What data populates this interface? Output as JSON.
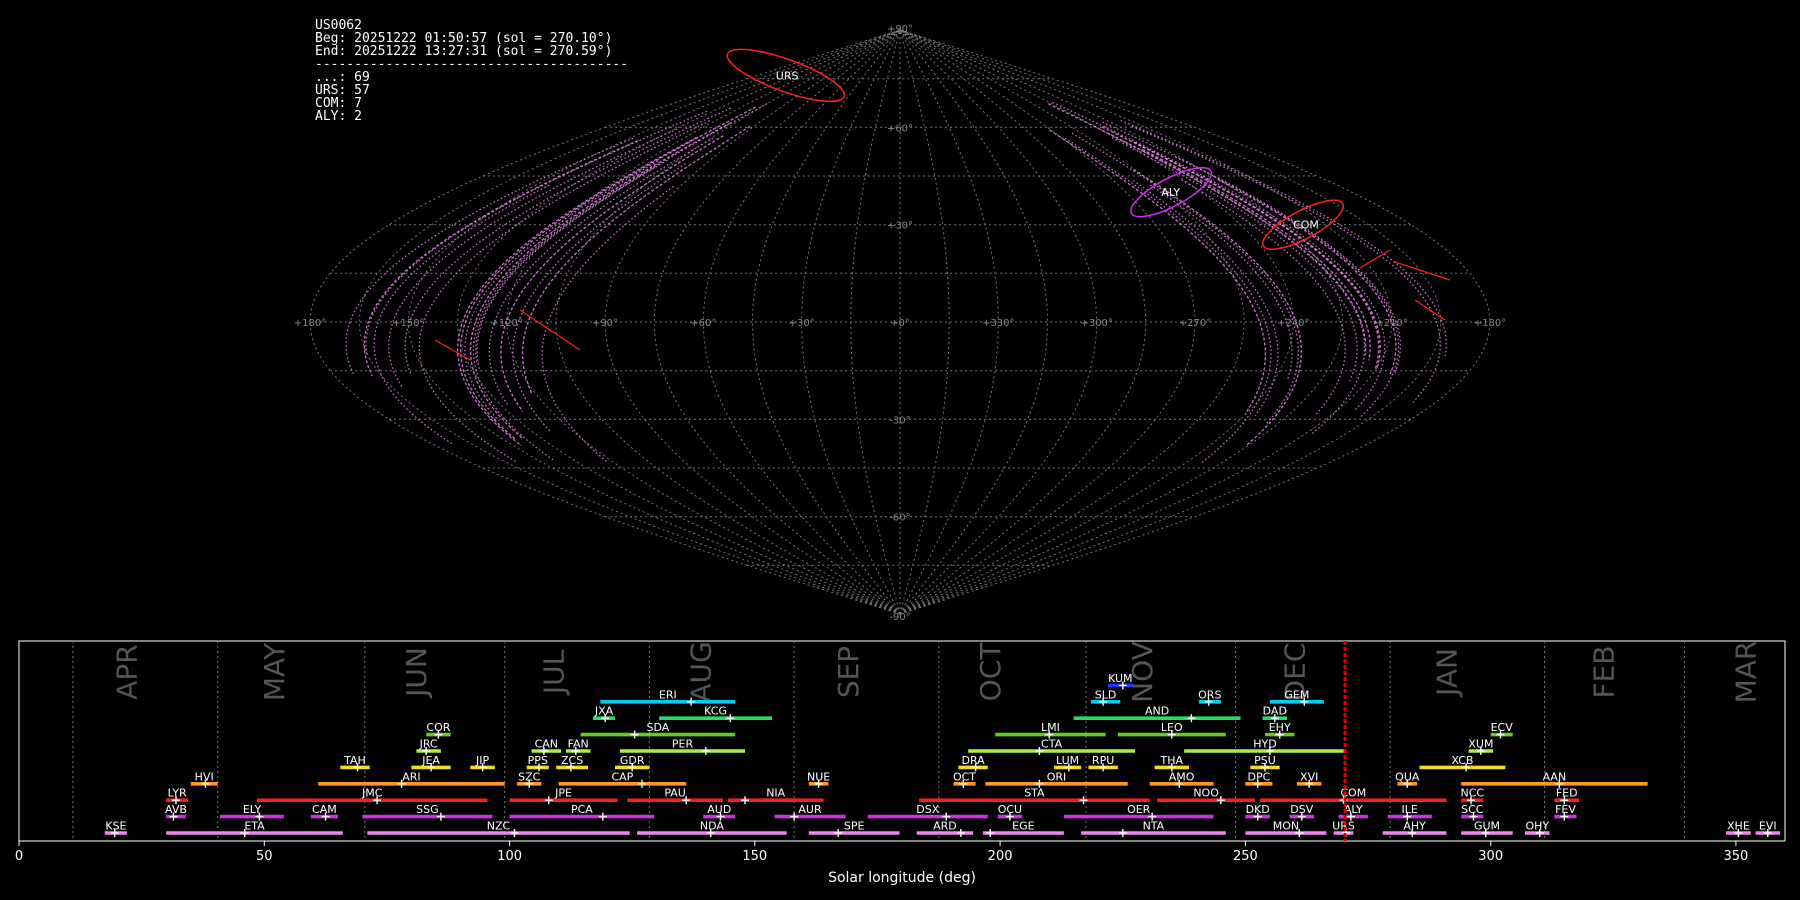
{
  "info_box": {
    "lines": [
      "US0062",
      "Beg: 20251222 01:50:57 (sol = 270.10°)",
      "End: 20251222 13:27:31 (sol = 270.59°)",
      "----------------------------------------",
      "...: 69",
      "URS: 57",
      "COM: 7",
      "ALY: 2"
    ]
  },
  "chart_data": [
    {
      "type": "scatter",
      "projection": "sinusoidal",
      "grid": true,
      "longitude_ticks": [
        "+180°",
        "+150°",
        "+120°",
        "+90°",
        "+60°",
        "+30°",
        "+0°",
        "+330°",
        "+300°",
        "+270°",
        "+240°",
        "+210°",
        "+180°"
      ],
      "latitude_ticks": [
        "+90°",
        "+60°",
        "+30°",
        "-30°",
        "-60°",
        "-90°"
      ],
      "radiants": [
        {
          "name": "URS",
          "color": "#ff2020",
          "lon": 216,
          "lat": 76
        },
        {
          "name": "ALY",
          "color": "#d030f0",
          "lon": 108,
          "lat": 40
        },
        {
          "name": "COM",
          "color": "#ff2020",
          "lon": 142,
          "lat": 30
        }
      ],
      "colors": {
        "grid": "#777777",
        "trails": "#ee88ee",
        "sporadic": "#ff2020"
      }
    },
    {
      "type": "gantt",
      "xlabel": "Solar longitude (deg)",
      "xlim": [
        0,
        360
      ],
      "xticks": [
        0,
        50,
        100,
        150,
        200,
        250,
        300,
        350
      ],
      "current_sol": 270.3,
      "months": [
        {
          "label": "APR",
          "sol_start": 11,
          "center": 24
        },
        {
          "label": "MAY",
          "sol_start": 40.5,
          "center": 54
        },
        {
          "label": "JUN",
          "sol_start": 70.5,
          "center": 83
        },
        {
          "label": "JUL",
          "sol_start": 99,
          "center": 111
        },
        {
          "label": "AUG",
          "sol_start": 128.5,
          "center": 141
        },
        {
          "label": "SEP",
          "sol_start": 158,
          "center": 171
        },
        {
          "label": "OCT",
          "sol_start": 187.5,
          "center": 200
        },
        {
          "label": "NOV",
          "sol_start": 217.5,
          "center": 231
        },
        {
          "label": "DEC",
          "sol_start": 248,
          "center": 262
        },
        {
          "label": "JAN",
          "sol_start": 279.5,
          "center": 293
        },
        {
          "label": "FEB",
          "sol_start": 311,
          "center": 325
        },
        {
          "label": "MAR",
          "sol_start": 339.5,
          "center": 354
        }
      ],
      "showers": [
        {
          "code": "KUM",
          "start": 222,
          "end": 227,
          "peak": 225,
          "row": 9,
          "color": "#2233ff"
        },
        {
          "code": "ERI",
          "start": 118.5,
          "end": 146,
          "peak": 137,
          "row": 8,
          "color": "#00ccee"
        },
        {
          "code": "SLD",
          "start": 218.5,
          "end": 224.5,
          "peak": 221,
          "row": 8,
          "color": "#00ccee"
        },
        {
          "code": "ORS",
          "start": 240.5,
          "end": 245,
          "peak": 242.5,
          "row": 8,
          "color": "#00ccee"
        },
        {
          "code": "GEM",
          "start": 255,
          "end": 266,
          "peak": 262,
          "row": 8,
          "color": "#00ccee"
        },
        {
          "code": "JXA",
          "start": 117,
          "end": 121.5,
          "peak": 119.5,
          "row": 7,
          "color": "#22dd66"
        },
        {
          "code": "KCG",
          "start": 130.5,
          "end": 153.5,
          "peak": 145,
          "row": 7,
          "color": "#22dd66"
        },
        {
          "code": "AND",
          "start": 215,
          "end": 249,
          "peak": 239,
          "row": 7,
          "color": "#22dd66"
        },
        {
          "code": "DAD",
          "start": 253.5,
          "end": 258.5,
          "peak": 256,
          "row": 7,
          "color": "#22dd66"
        },
        {
          "code": "COR",
          "start": 83,
          "end": 88,
          "peak": 85.5,
          "row": 6,
          "color": "#66cc22"
        },
        {
          "code": "SDA",
          "start": 114.5,
          "end": 146,
          "peak": 125.5,
          "row": 6,
          "color": "#66cc22"
        },
        {
          "code": "LMI",
          "start": 199,
          "end": 221.5,
          "peak": 210,
          "row": 6,
          "color": "#66cc22"
        },
        {
          "code": "LEO",
          "start": 224,
          "end": 246,
          "peak": 235,
          "row": 6,
          "color": "#66cc22"
        },
        {
          "code": "EHY",
          "start": 254,
          "end": 260,
          "peak": 257,
          "row": 6,
          "color": "#66cc22"
        },
        {
          "code": "ECV",
          "start": 300,
          "end": 304.5,
          "peak": 302,
          "row": 6,
          "color": "#66cc22"
        },
        {
          "code": "JRC",
          "start": 81,
          "end": 86,
          "peak": 83,
          "row": 5,
          "color": "#aaee44"
        },
        {
          "code": "CAN",
          "start": 104.5,
          "end": 110.5,
          "peak": 107,
          "row": 5,
          "color": "#aaee44"
        },
        {
          "code": "FAN",
          "start": 111.5,
          "end": 116.5,
          "peak": 113.5,
          "row": 5,
          "color": "#aaee44"
        },
        {
          "code": "PER",
          "start": 122.5,
          "end": 148,
          "peak": 140,
          "row": 5,
          "color": "#aaee44"
        },
        {
          "code": "CTA",
          "start": 193.5,
          "end": 227.5,
          "peak": 208,
          "row": 5,
          "color": "#aaee44"
        },
        {
          "code": "HYD",
          "start": 237.5,
          "end": 270.5,
          "peak": 255,
          "row": 5,
          "color": "#aaee44"
        },
        {
          "code": "XUM",
          "start": 295.5,
          "end": 300.5,
          "peak": 298,
          "row": 5,
          "color": "#aaee44"
        },
        {
          "code": "TAH",
          "start": 65.5,
          "end": 71.5,
          "peak": 69,
          "row": 4,
          "color": "#eedd22"
        },
        {
          "code": "JEA",
          "start": 80,
          "end": 88,
          "peak": 84,
          "row": 4,
          "color": "#eedd22"
        },
        {
          "code": "JIP",
          "start": 92,
          "end": 97,
          "peak": 94.5,
          "row": 4,
          "color": "#eedd22"
        },
        {
          "code": "PPS",
          "start": 103.5,
          "end": 108,
          "peak": 106,
          "row": 4,
          "color": "#eedd22"
        },
        {
          "code": "ZCS",
          "start": 109.5,
          "end": 116,
          "peak": 112.5,
          "row": 4,
          "color": "#eedd22"
        },
        {
          "code": "GDR",
          "start": 121.5,
          "end": 128.5,
          "peak": 125,
          "row": 4,
          "color": "#eedd22"
        },
        {
          "code": "DRA",
          "start": 191.5,
          "end": 197.5,
          "peak": 195,
          "row": 4,
          "color": "#eedd22"
        },
        {
          "code": "LUM",
          "start": 211,
          "end": 216.5,
          "peak": 214,
          "row": 4,
          "color": "#eedd22"
        },
        {
          "code": "RPU",
          "start": 218,
          "end": 224,
          "peak": 221,
          "row": 4,
          "color": "#eedd22"
        },
        {
          "code": "THA",
          "start": 231.5,
          "end": 238.5,
          "peak": 235,
          "row": 4,
          "color": "#eedd22"
        },
        {
          "code": "PSU",
          "start": 251,
          "end": 257,
          "peak": 254,
          "row": 4,
          "color": "#eedd22"
        },
        {
          "code": "XCB",
          "start": 285.5,
          "end": 303,
          "peak": 295,
          "row": 4,
          "color": "#eedd22"
        },
        {
          "code": "HVI",
          "start": 35,
          "end": 40.5,
          "peak": 38,
          "row": 3,
          "color": "#ff9922"
        },
        {
          "code": "ARI",
          "start": 61,
          "end": 99,
          "peak": 78,
          "row": 3,
          "color": "#ff9922"
        },
        {
          "code": "SZC",
          "start": 101.5,
          "end": 106.5,
          "peak": 104,
          "row": 3,
          "color": "#ff9922"
        },
        {
          "code": "CAP",
          "start": 110,
          "end": 136,
          "peak": 127,
          "row": 3,
          "color": "#ff9922"
        },
        {
          "code": "NUE",
          "start": 161,
          "end": 165,
          "peak": 163,
          "row": 3,
          "color": "#ff9922"
        },
        {
          "code": "OCT",
          "start": 190.5,
          "end": 195,
          "peak": 192.5,
          "row": 3,
          "color": "#ff9922"
        },
        {
          "code": "ORI",
          "start": 197,
          "end": 226,
          "peak": 208,
          "row": 3,
          "color": "#ff9922"
        },
        {
          "code": "AMO",
          "start": 230.5,
          "end": 243.5,
          "peak": 236.5,
          "row": 3,
          "color": "#ff9922"
        },
        {
          "code": "DPC",
          "start": 250,
          "end": 255.5,
          "peak": 252.5,
          "row": 3,
          "color": "#ff9922"
        },
        {
          "code": "XVI",
          "start": 260.5,
          "end": 265.5,
          "peak": 263,
          "row": 3,
          "color": "#ff9922"
        },
        {
          "code": "QUA",
          "start": 281,
          "end": 285,
          "peak": 283,
          "row": 3,
          "color": "#ff9922"
        },
        {
          "code": "AAN",
          "start": 294,
          "end": 332,
          "peak": 314,
          "row": 3,
          "color": "#ff9922"
        },
        {
          "code": "LYR",
          "start": 30,
          "end": 34.5,
          "peak": 32,
          "row": 2,
          "color": "#ee2222"
        },
        {
          "code": "JMC",
          "start": 48.5,
          "end": 95.5,
          "peak": 73,
          "row": 2,
          "color": "#ee2222"
        },
        {
          "code": "JPE",
          "start": 100,
          "end": 122,
          "peak": 108,
          "row": 2,
          "color": "#ee2222"
        },
        {
          "code": "PAU",
          "start": 124,
          "end": 143.5,
          "peak": 136,
          "row": 2,
          "color": "#ee2222"
        },
        {
          "code": "NIA",
          "start": 144.5,
          "end": 164,
          "peak": 148,
          "row": 2,
          "color": "#ee2222"
        },
        {
          "code": "STA",
          "start": 183.5,
          "end": 230.5,
          "peak": 217,
          "row": 2,
          "color": "#ee2222"
        },
        {
          "code": "NOO",
          "start": 232,
          "end": 252,
          "peak": 245,
          "row": 2,
          "color": "#ee2222"
        },
        {
          "code": "COM",
          "start": 253,
          "end": 291,
          "peak": 270,
          "row": 2,
          "color": "#ee2222"
        },
        {
          "code": "NCC",
          "start": 294,
          "end": 298.5,
          "peak": 296,
          "row": 2,
          "color": "#ee2222"
        },
        {
          "code": "FED",
          "start": 313,
          "end": 318,
          "peak": 315,
          "row": 2,
          "color": "#ee2222"
        },
        {
          "code": "AVB",
          "start": 30,
          "end": 34,
          "peak": 31.5,
          "row": 1,
          "color": "#cc33dd"
        },
        {
          "code": "ELY",
          "start": 41,
          "end": 54,
          "peak": 49,
          "row": 1,
          "color": "#cc33dd"
        },
        {
          "code": "CAM",
          "start": 59.5,
          "end": 65,
          "peak": 62.5,
          "row": 1,
          "color": "#cc33dd"
        },
        {
          "code": "SSG",
          "start": 70,
          "end": 96.5,
          "peak": 86,
          "row": 1,
          "color": "#cc33dd"
        },
        {
          "code": "PCA",
          "start": 100,
          "end": 129.5,
          "peak": 119,
          "row": 1,
          "color": "#cc33dd"
        },
        {
          "code": "AUD",
          "start": 139.5,
          "end": 146,
          "peak": 143,
          "row": 1,
          "color": "#cc33dd"
        },
        {
          "code": "AUR",
          "start": 154,
          "end": 168.5,
          "peak": 158,
          "row": 1,
          "color": "#cc33dd"
        },
        {
          "code": "DSX",
          "start": 173,
          "end": 197.5,
          "peak": 189,
          "row": 1,
          "color": "#cc33dd"
        },
        {
          "code": "OCU",
          "start": 199.5,
          "end": 204.5,
          "peak": 202,
          "row": 1,
          "color": "#cc33dd"
        },
        {
          "code": "OER",
          "start": 213,
          "end": 243.5,
          "peak": 231,
          "row": 1,
          "color": "#cc33dd"
        },
        {
          "code": "DKD",
          "start": 250,
          "end": 255,
          "peak": 252.5,
          "row": 1,
          "color": "#cc33dd"
        },
        {
          "code": "DSV",
          "start": 259,
          "end": 264,
          "peak": 261.5,
          "row": 1,
          "color": "#cc33dd"
        },
        {
          "code": "ALY",
          "start": 269,
          "end": 275,
          "peak": 271.5,
          "row": 1,
          "color": "#cc33dd"
        },
        {
          "code": "ILE",
          "start": 279,
          "end": 288,
          "peak": 283,
          "row": 1,
          "color": "#cc33dd"
        },
        {
          "code": "SCC",
          "start": 294,
          "end": 298.5,
          "peak": 296.5,
          "row": 1,
          "color": "#cc33dd"
        },
        {
          "code": "FEV",
          "start": 313,
          "end": 317.5,
          "peak": 315,
          "row": 1,
          "color": "#cc33dd"
        },
        {
          "code": "KSE",
          "start": 17.5,
          "end": 22,
          "peak": 19.5,
          "row": 0,
          "color": "#ee88ee"
        },
        {
          "code": "ETA",
          "start": 30,
          "end": 66,
          "peak": 46,
          "row": 0,
          "color": "#ee88ee"
        },
        {
          "code": "NZC",
          "start": 71,
          "end": 124.5,
          "peak": 101,
          "row": 0,
          "color": "#ee88ee"
        },
        {
          "code": "NDA",
          "start": 126,
          "end": 156.5,
          "peak": 141,
          "row": 0,
          "color": "#ee88ee"
        },
        {
          "code": "SPE",
          "start": 161,
          "end": 179.5,
          "peak": 167,
          "row": 0,
          "color": "#ee88ee"
        },
        {
          "code": "ARD",
          "start": 183,
          "end": 194.5,
          "peak": 192,
          "row": 0,
          "color": "#ee88ee"
        },
        {
          "code": "EGE",
          "start": 196.5,
          "end": 213,
          "peak": 198,
          "row": 0,
          "color": "#ee88ee"
        },
        {
          "code": "NTA",
          "start": 216.5,
          "end": 246,
          "peak": 225,
          "row": 0,
          "color": "#ee88ee"
        },
        {
          "code": "MON",
          "start": 250,
          "end": 266.5,
          "peak": 261,
          "row": 0,
          "color": "#ee88ee"
        },
        {
          "code": "URS",
          "start": 268,
          "end": 272,
          "peak": 270.5,
          "row": 0,
          "color": "#ee88ee"
        },
        {
          "code": "AHY",
          "start": 278,
          "end": 291,
          "peak": 284,
          "row": 0,
          "color": "#ee88ee"
        },
        {
          "code": "GUM",
          "start": 294,
          "end": 304.5,
          "peak": 299,
          "row": 0,
          "color": "#ee88ee"
        },
        {
          "code": "OHY",
          "start": 307,
          "end": 312,
          "peak": 310,
          "row": 0,
          "color": "#ee88ee"
        },
        {
          "code": "XHE",
          "start": 348,
          "end": 353,
          "peak": 350.5,
          "row": 0,
          "color": "#ee88ee"
        },
        {
          "code": "EVI",
          "start": 354,
          "end": 359,
          "peak": 356.5,
          "row": 0,
          "color": "#ee88ee"
        }
      ]
    }
  ]
}
